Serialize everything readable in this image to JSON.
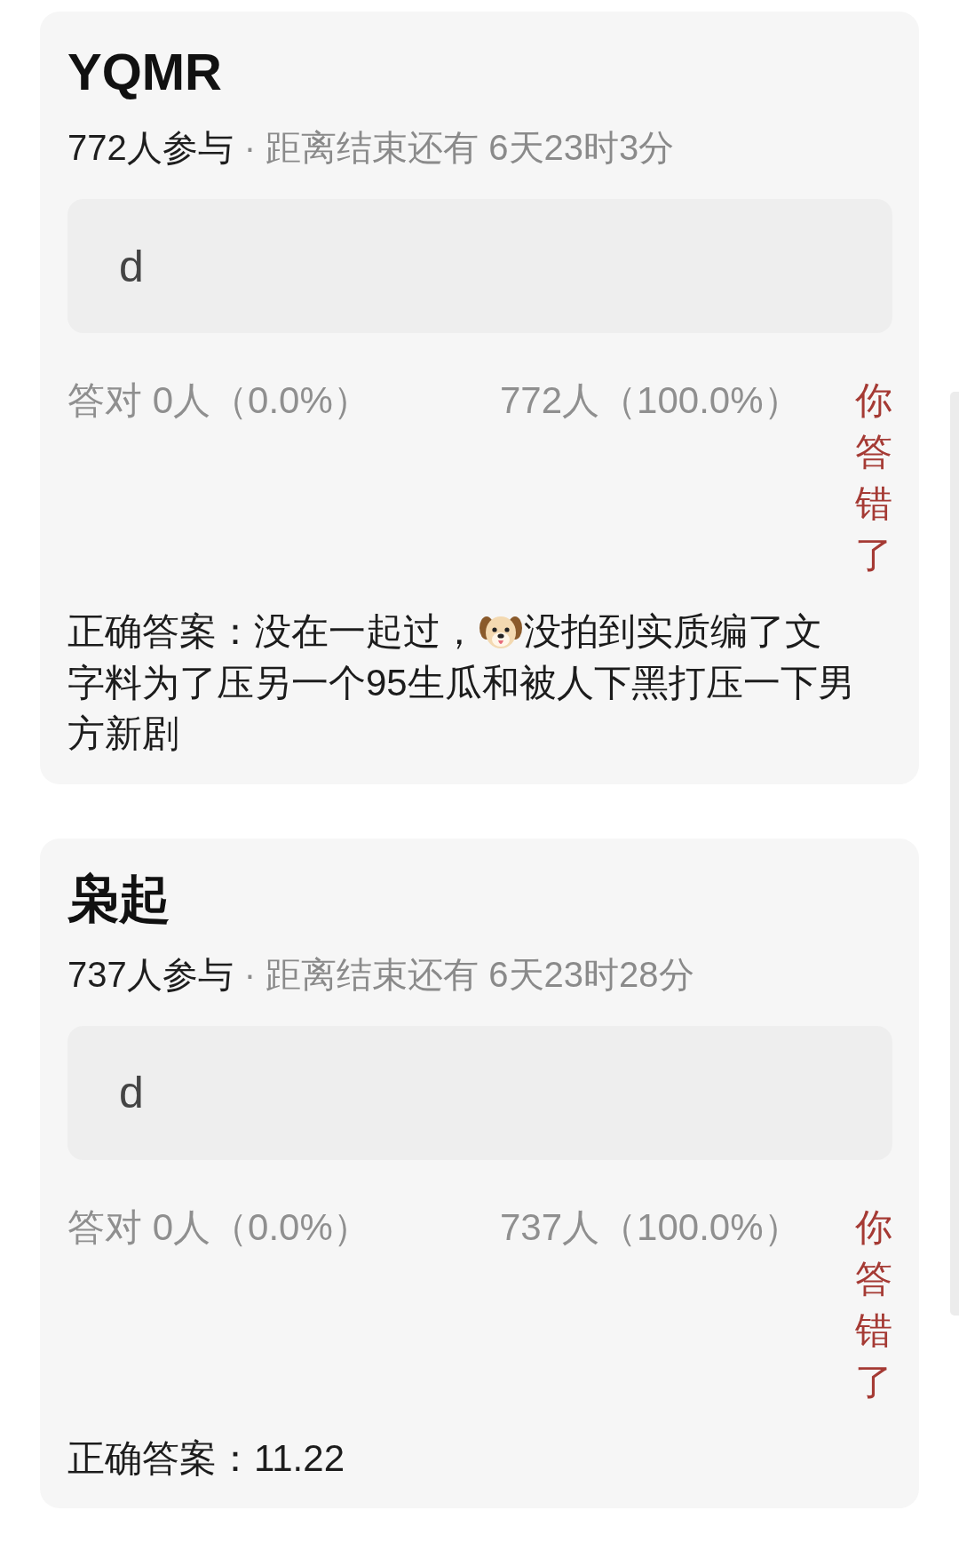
{
  "cards": [
    {
      "title": "YQMR",
      "participants": "772人参与",
      "countdown": "· 距离结束还有 6天23时3分",
      "user_answer": "d",
      "correct_stat": "答对 0人（0.0%）",
      "other_stat": "772人（100.0%）",
      "result": "你答错了",
      "answer_lines": [
        {
          "parts": [
            {
              "kind": "text",
              "text": "正确答案：没在一起过，"
            },
            {
              "kind": "emoji"
            },
            {
              "kind": "text",
              "text": "没拍到实质编了文"
            }
          ]
        },
        {
          "parts": [
            {
              "kind": "text",
              "text": "字料为了压另一个95生瓜和被人下黑打压一下男"
            }
          ]
        },
        {
          "parts": [
            {
              "kind": "text",
              "text": "方新剧"
            }
          ]
        }
      ]
    },
    {
      "title": "枭起",
      "participants": "737人参与",
      "countdown": "· 距离结束还有 6天23时28分",
      "user_answer": "d",
      "correct_stat": "答对 0人（0.0%）",
      "other_stat": "737人（100.0%）",
      "result": "你答错了",
      "answer_lines": [
        {
          "parts": [
            {
              "kind": "text",
              "text": "正确答案：11.22"
            }
          ]
        }
      ]
    }
  ]
}
